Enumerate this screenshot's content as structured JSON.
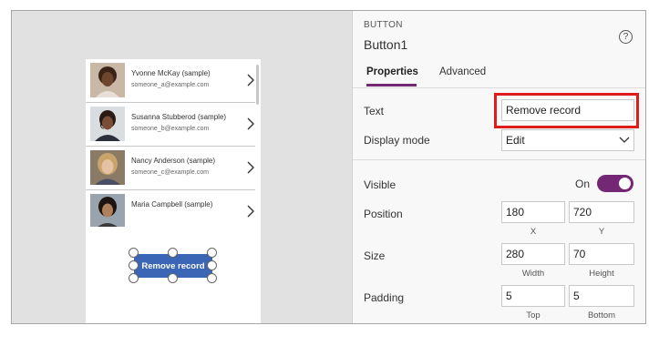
{
  "gallery": {
    "items": [
      {
        "name": "Yvonne McKay (sample)",
        "email": "someone_a@example.com"
      },
      {
        "name": "Susanna Stubberod (sample)",
        "email": "someone_b@example.com"
      },
      {
        "name": "Nancy Anderson (sample)",
        "email": "someone_c@example.com"
      },
      {
        "name": "Maria Campbell (sample)",
        "email": ""
      }
    ]
  },
  "canvas_button": {
    "label": "Remove record"
  },
  "panel": {
    "control_type": "BUTTON",
    "control_name": "Button1",
    "help_icon": "?",
    "tabs": [
      {
        "label": "Properties",
        "active": true
      },
      {
        "label": "Advanced",
        "active": false
      }
    ],
    "text": {
      "label": "Text",
      "value": "Remove record"
    },
    "display_mode": {
      "label": "Display mode",
      "value": "Edit"
    },
    "visible": {
      "label": "Visible",
      "state": "On"
    },
    "position": {
      "label": "Position",
      "x": "180",
      "y": "720",
      "x_caption": "X",
      "y_caption": "Y"
    },
    "size": {
      "label": "Size",
      "width": "280",
      "height": "70",
      "width_caption": "Width",
      "height_caption": "Height"
    },
    "padding": {
      "label": "Padding",
      "top": "5",
      "bottom": "5",
      "top_caption": "Top",
      "bottom_caption": "Bottom"
    }
  },
  "colors": {
    "accent": "#742774",
    "button": "#3a66b5",
    "highlight": "#e01b1b",
    "canvas": "#e1e1e1"
  },
  "icons": [
    "chevron-right-icon",
    "chevron-down-icon",
    "help-icon",
    "person-photo"
  ]
}
